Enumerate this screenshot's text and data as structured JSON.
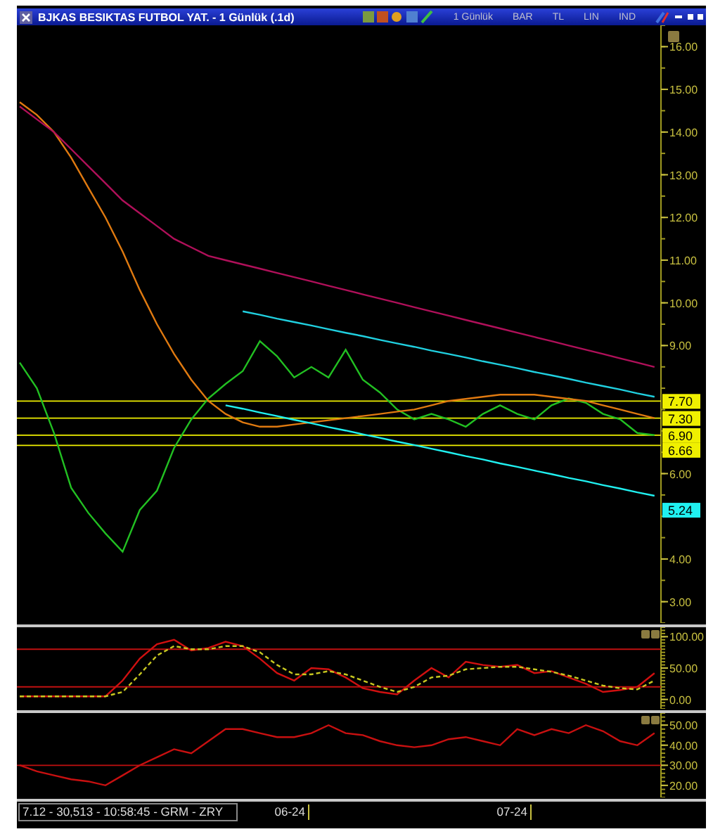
{
  "window": {
    "title": "BJKAS BESIKTAS FUTBOL YAT. - 1 Günlük (.1d)",
    "toolbar": [
      "1 Günlük",
      "BAR",
      "TL",
      "LIN",
      "IND"
    ]
  },
  "price_chart": {
    "chart_data": {
      "type": "line",
      "ylim": [
        2.5,
        16.5
      ],
      "yticks": [
        {
          "value": 3,
          "label": "3.00"
        },
        {
          "value": 4,
          "label": "4.00"
        },
        {
          "value": 6,
          "label": "6.00"
        },
        {
          "value": 9,
          "label": "9.00"
        },
        {
          "value": 10,
          "label": "10.00"
        },
        {
          "value": 11,
          "label": "11.00"
        },
        {
          "value": 12,
          "label": "12.00"
        },
        {
          "value": 13,
          "label": "13.00"
        },
        {
          "value": 14,
          "label": "14.00"
        },
        {
          "value": 15,
          "label": "15.00"
        },
        {
          "value": 16,
          "label": "16.00"
        }
      ],
      "series": [
        {
          "color": "#22c022",
          "values": [
            8.6,
            8.0,
            6.95,
            5.67,
            5.08,
            4.6,
            4.17,
            5.15,
            5.6,
            6.6,
            7.27,
            7.76,
            8.1,
            8.4,
            9.1,
            8.75,
            8.25,
            8.5,
            8.25,
            8.9,
            8.2,
            7.9,
            7.5,
            7.27,
            7.4,
            7.27,
            7.1,
            7.4,
            7.6,
            7.4,
            7.27,
            7.6,
            7.76,
            7.66,
            7.4,
            7.27,
            6.95,
            6.9
          ]
        },
        {
          "color": "#e07a10",
          "values": [
            14.7,
            14.4,
            14.0,
            13.4,
            12.7,
            12.0,
            11.2,
            10.3,
            9.5,
            8.8,
            8.2,
            7.7,
            7.4,
            7.2,
            7.1,
            7.1,
            7.15,
            7.2,
            7.25,
            7.3,
            7.35,
            7.4,
            7.45,
            7.5,
            7.6,
            7.7,
            7.75,
            7.8,
            7.85,
            7.85,
            7.85,
            7.8,
            7.75,
            7.7,
            7.6,
            7.5,
            7.4,
            7.3
          ]
        },
        {
          "color": "#b0105a",
          "values": [
            14.6,
            14.3,
            14.0,
            13.6,
            13.2,
            12.8,
            12.4,
            12.1,
            11.8,
            11.5,
            11.3,
            11.1,
            11.0,
            10.9,
            10.8,
            10.7,
            10.6,
            10.5,
            10.4,
            10.3,
            10.2,
            10.1,
            10.0,
            9.9,
            9.8,
            9.7,
            9.6,
            9.5,
            9.4,
            9.3,
            9.2,
            9.1,
            9.0,
            8.9,
            8.8,
            8.7,
            8.6,
            8.5
          ]
        },
        {
          "color": "#20d0e0",
          "values": [
            null,
            null,
            null,
            null,
            null,
            null,
            null,
            null,
            null,
            null,
            null,
            null,
            null,
            9.8,
            9.72,
            9.63,
            9.55,
            9.47,
            9.38,
            9.3,
            9.22,
            9.13,
            9.05,
            8.97,
            8.88,
            8.8,
            8.72,
            8.63,
            8.55,
            8.47,
            8.38,
            8.3,
            8.22,
            8.13,
            8.05,
            7.97,
            7.88,
            7.8
          ]
        },
        {
          "color": "#20f0f0",
          "values": [
            null,
            null,
            null,
            null,
            null,
            null,
            null,
            null,
            null,
            null,
            null,
            null,
            7.6,
            7.52,
            7.43,
            7.35,
            7.26,
            7.18,
            7.09,
            7.01,
            6.92,
            6.84,
            6.75,
            6.67,
            6.58,
            6.5,
            6.41,
            6.33,
            6.24,
            6.16,
            6.07,
            5.99,
            5.9,
            5.82,
            5.73,
            5.65,
            5.56,
            5.48
          ]
        }
      ],
      "ref_lines": [
        {
          "axis": "y",
          "value": 7.7,
          "label": "7.70",
          "color": "#f0f000"
        },
        {
          "axis": "y",
          "value": 7.3,
          "label": "7.30",
          "color": "#f0f000"
        },
        {
          "axis": "y",
          "value": 6.9,
          "label": "6.90",
          "color": "#f0f000"
        },
        {
          "axis": "y",
          "value": 6.66,
          "label": "6.66",
          "color": "#f0f000"
        }
      ],
      "annotations": [
        "5.24"
      ]
    }
  },
  "oscillator_panel": {
    "chart_data": {
      "type": "line",
      "ylim": [
        -15,
        115
      ],
      "yticks": [
        {
          "value": 0,
          "label": "0.00"
        },
        {
          "value": 50,
          "label": "50.00"
        },
        {
          "value": 100,
          "label": "100.00"
        }
      ],
      "series": [
        {
          "color": "#d01010",
          "values": [
            5,
            5,
            5,
            5,
            5,
            5,
            30,
            65,
            88,
            95,
            78,
            82,
            92,
            85,
            65,
            42,
            30,
            50,
            48,
            35,
            18,
            12,
            8,
            30,
            50,
            35,
            60,
            55,
            52,
            55,
            42,
            45,
            35,
            25,
            12,
            15,
            20,
            42
          ]
        },
        {
          "color": "#c8c820",
          "line_style": "dashed",
          "values": [
            5,
            5,
            5,
            5,
            5,
            5,
            12,
            40,
            70,
            85,
            80,
            80,
            85,
            85,
            75,
            55,
            40,
            40,
            45,
            40,
            30,
            20,
            12,
            20,
            35,
            38,
            48,
            50,
            52,
            52,
            48,
            44,
            38,
            30,
            22,
            18,
            16,
            30
          ]
        }
      ],
      "ref_lines": [
        {
          "axis": "y",
          "value": 80,
          "color": "#c01010"
        },
        {
          "axis": "y",
          "value": 20,
          "color": "#c01010"
        }
      ]
    }
  },
  "momentum_panel": {
    "chart_data": {
      "type": "line",
      "ylim": [
        14,
        56
      ],
      "yticks": [
        {
          "value": 20,
          "label": "20.00"
        },
        {
          "value": 30,
          "label": "30.00"
        },
        {
          "value": 40,
          "label": "40.00"
        },
        {
          "value": 50,
          "label": "50.00"
        }
      ],
      "series": [
        {
          "color": "#c81010",
          "values": [
            30,
            27,
            25,
            23,
            22,
            20,
            25,
            30,
            34,
            38,
            36,
            42,
            48,
            48,
            46,
            44,
            44,
            46,
            50,
            46,
            45,
            42,
            40,
            39,
            40,
            43,
            44,
            42,
            40,
            48,
            45,
            48,
            46,
            50,
            47,
            42,
            40,
            46
          ]
        }
      ],
      "ref_lines": [
        {
          "axis": "y",
          "value": 30,
          "color": "#c01010"
        }
      ]
    }
  },
  "status_bar": {
    "info": "7.12 - 30,513 - 10:58:45 - GRM - ZRY",
    "dates": [
      "06-24",
      "07-24"
    ]
  }
}
